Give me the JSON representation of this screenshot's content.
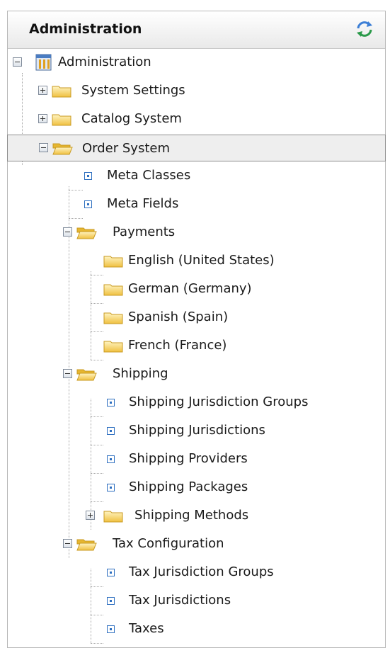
{
  "panel": {
    "title": "Administration"
  },
  "tree": {
    "root": "Administration",
    "system_settings": "System Settings",
    "catalog_system": "Catalog System",
    "order_system": "Order System",
    "meta_classes": "Meta Classes",
    "meta_fields": "Meta Fields",
    "payments": "Payments",
    "english_us": "English (United States)",
    "german": "German (Germany)",
    "spanish": "Spanish (Spain)",
    "french": "French (France)",
    "shipping": "Shipping",
    "shipping_jurisdiction_groups": "Shipping Jurisdiction Groups",
    "shipping_jurisdictions": "Shipping Jurisdictions",
    "shipping_providers": "Shipping Providers",
    "shipping_packages": "Shipping Packages",
    "shipping_methods": "Shipping Methods",
    "tax_configuration": "Tax Configuration",
    "tax_jurisdiction_groups": "Tax Jurisdiction Groups",
    "tax_jurisdictions": "Tax Jurisdictions",
    "taxes": "Taxes"
  },
  "colors": {
    "folder": "#f2c94c",
    "leaf_icon": "#2e6fc0",
    "selected_row": "#eeeeee"
  },
  "icons": [
    "refresh-icon",
    "admin-icon",
    "folder-closed-icon",
    "folder-open-icon",
    "leaf-node-icon",
    "expand-icon",
    "collapse-icon"
  ]
}
